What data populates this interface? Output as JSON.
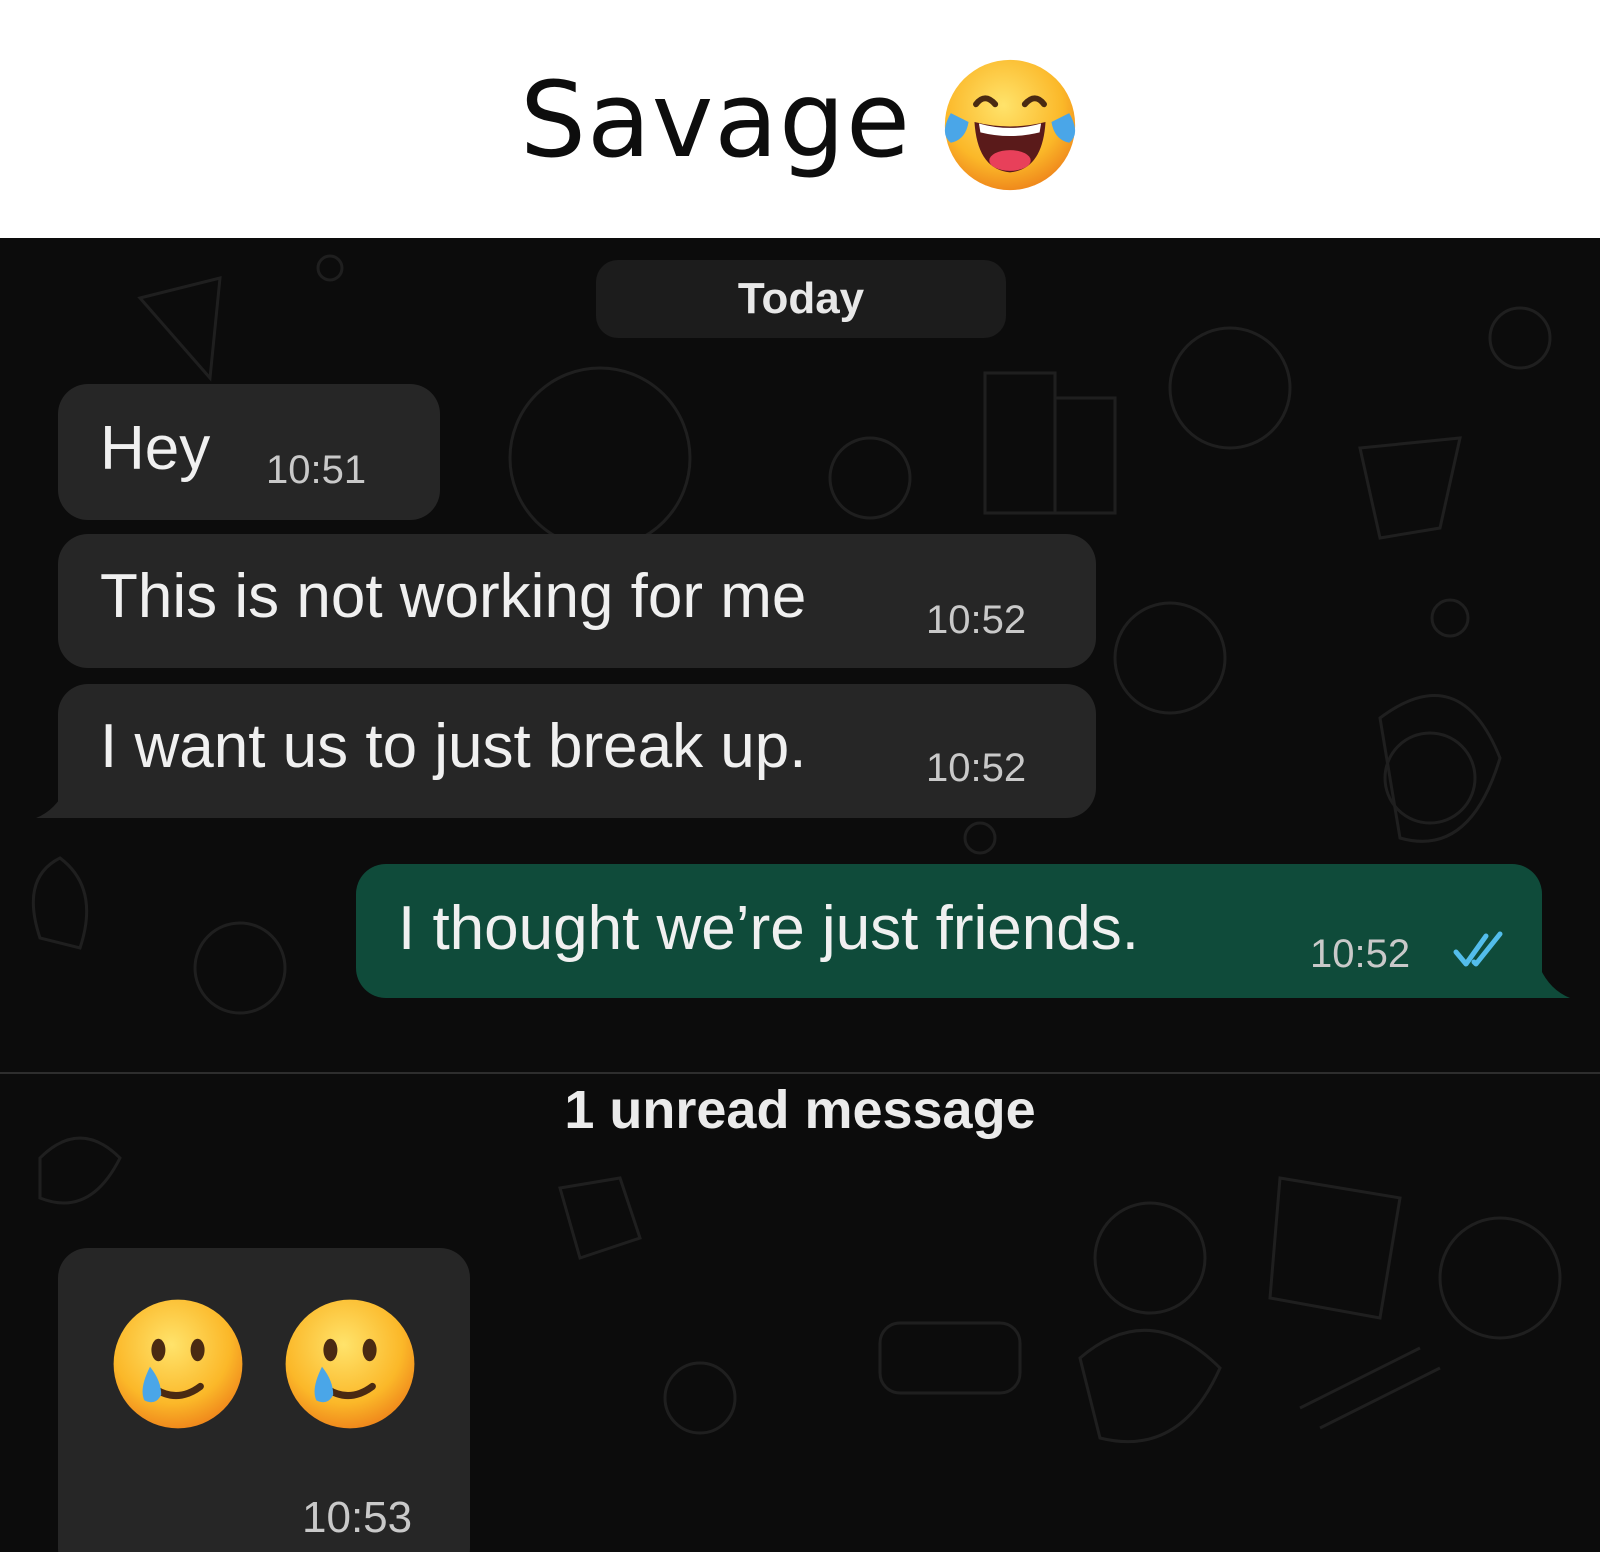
{
  "caption": {
    "title": "Savage",
    "emoji_icon": "face-with-tears-of-joy-icon"
  },
  "chat": {
    "date_label": "Today",
    "messages": [
      {
        "direction": "incoming",
        "text": "Hey",
        "time": "10:51"
      },
      {
        "direction": "incoming",
        "text": "This is not working for me",
        "time": "10:52"
      },
      {
        "direction": "incoming",
        "text": "I want us to just break up.",
        "time": "10:52"
      },
      {
        "direction": "outgoing",
        "text": "I thought we’re just friends.",
        "time": "10:52",
        "status_icon": "double-check-read-icon"
      }
    ],
    "unread_label": "1 unread message",
    "emoji_message": {
      "emojis": [
        "smiling-face-with-tear-icon",
        "smiling-face-with-tear-icon"
      ],
      "time": "10:53"
    }
  },
  "colors": {
    "background": "#0c0c0c",
    "incoming_bubble": "#262626",
    "outgoing_bubble": "#0f4b3a",
    "read_check": "#53bdeb"
  }
}
